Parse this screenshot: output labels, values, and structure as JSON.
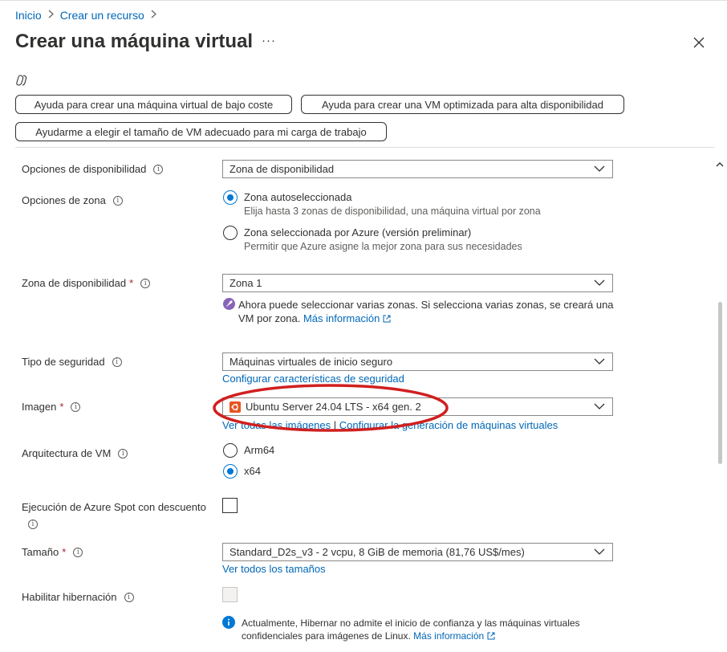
{
  "breadcrumb": {
    "home": "Inicio",
    "create_resource": "Crear un recurso"
  },
  "page": {
    "title": "Crear una máquina virtual",
    "more": "···"
  },
  "help_buttons": {
    "low_cost": "Ayuda para crear una máquina virtual de bajo coste",
    "high_availability": "Ayuda para crear una VM optimizada para alta disponibilidad",
    "vm_size": "Ayudarme a elegir el tamaño de VM adecuado para mi carga de trabajo"
  },
  "form": {
    "availability_options": {
      "label": "Opciones de disponibilidad",
      "value": "Zona de disponibilidad"
    },
    "zone_options": {
      "label": "Opciones de zona",
      "options": [
        {
          "label": "Zona autoseleccionada",
          "description": "Elija hasta 3 zonas de disponibilidad, una máquina virtual por zona",
          "selected": true
        },
        {
          "label": "Zona seleccionada por Azure (versión preliminar)",
          "description": "Permitir que Azure asigne la mejor zona para sus necesidades",
          "selected": false
        }
      ]
    },
    "availability_zone": {
      "label": "Zona de disponibilidad",
      "required": "*",
      "value": "Zona 1",
      "note": "Ahora puede seleccionar varias zonas. Si selecciona varias zonas, se creará una VM por zona.",
      "note_link": "Más información"
    },
    "security_type": {
      "label": "Tipo de seguridad",
      "value": "Máquinas virtuales de inicio seguro",
      "link": "Configurar características de seguridad"
    },
    "image": {
      "label": "Imagen",
      "required": "*",
      "value": "Ubuntu Server 24.04 LTS - x64 gen. 2",
      "link_all": "Ver todas las imágenes",
      "link_separator": "|",
      "link_config": "Configurar la generación de máquinas virtuales"
    },
    "vm_architecture": {
      "label": "Arquitectura de VM",
      "options": [
        {
          "label": "Arm64",
          "selected": false
        },
        {
          "label": "x64",
          "selected": true
        }
      ]
    },
    "spot": {
      "label": "Ejecución de Azure Spot con descuento",
      "checked": false
    },
    "size": {
      "label": "Tamaño",
      "required": "*",
      "value": "Standard_D2s_v3 - 2 vcpu, 8 GiB de memoria (81,76 US$/mes)",
      "link": "Ver todos los tamaños"
    },
    "hibernation": {
      "label": "Habilitar hibernación",
      "checked": false,
      "disabled": true,
      "note": "Actualmente, Hibernar no admite el inicio de confianza y las máquinas virtuales confidenciales para imágenes de Linux.",
      "note_link": "Más información"
    }
  },
  "colors": {
    "accent": "#0078d4",
    "link": "#0067b8",
    "required": "#a4262c",
    "annotation": "#d11f1f",
    "ubuntu": "#e95420",
    "info_note": "#0078d4",
    "rocket": "#8764b8"
  },
  "icons": [
    "chevron-right-icon",
    "more-icon",
    "close-icon",
    "copilot-icon",
    "info-icon",
    "chevron-down-icon",
    "external-link-icon",
    "rocket-icon",
    "ubuntu-icon",
    "info-filled-icon",
    "chevron-up-icon"
  ]
}
